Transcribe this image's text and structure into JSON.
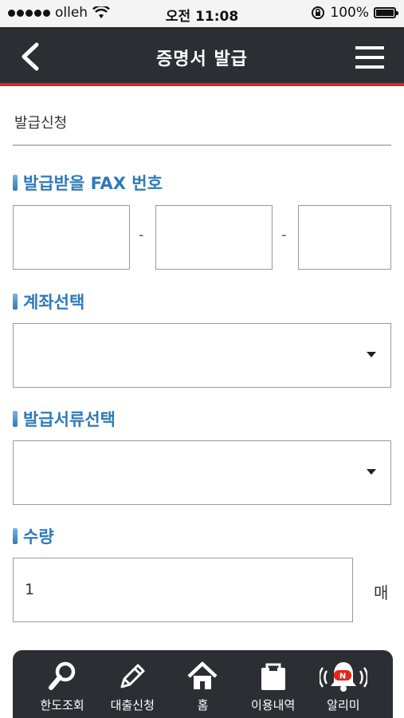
{
  "status": {
    "carrier": "olleh",
    "time": "오전 11:08",
    "battery": "100%"
  },
  "header": {
    "title": "증명서 발급"
  },
  "section": {
    "title": "발급신청"
  },
  "fax": {
    "label": "발급받을 FAX 번호",
    "part1": "",
    "part2": "",
    "part3": "",
    "separator": "-"
  },
  "account": {
    "label": "계좌선택",
    "selected": ""
  },
  "document": {
    "label": "발급서류선택",
    "selected": ""
  },
  "quantity": {
    "label": "수량",
    "value": "1",
    "unit": "매"
  },
  "tabs": [
    {
      "label": "한도조회",
      "icon": "search-icon"
    },
    {
      "label": "대출신청",
      "icon": "pencil-icon"
    },
    {
      "label": "홈",
      "icon": "home-icon"
    },
    {
      "label": "이용내역",
      "icon": "bag-icon"
    },
    {
      "label": "알리미",
      "icon": "bell-icon"
    }
  ],
  "notification_badge": "N",
  "colors": {
    "header_bg": "#2b2e33",
    "accent_red": "#e1261c",
    "label_blue": "#2e7ab8"
  }
}
